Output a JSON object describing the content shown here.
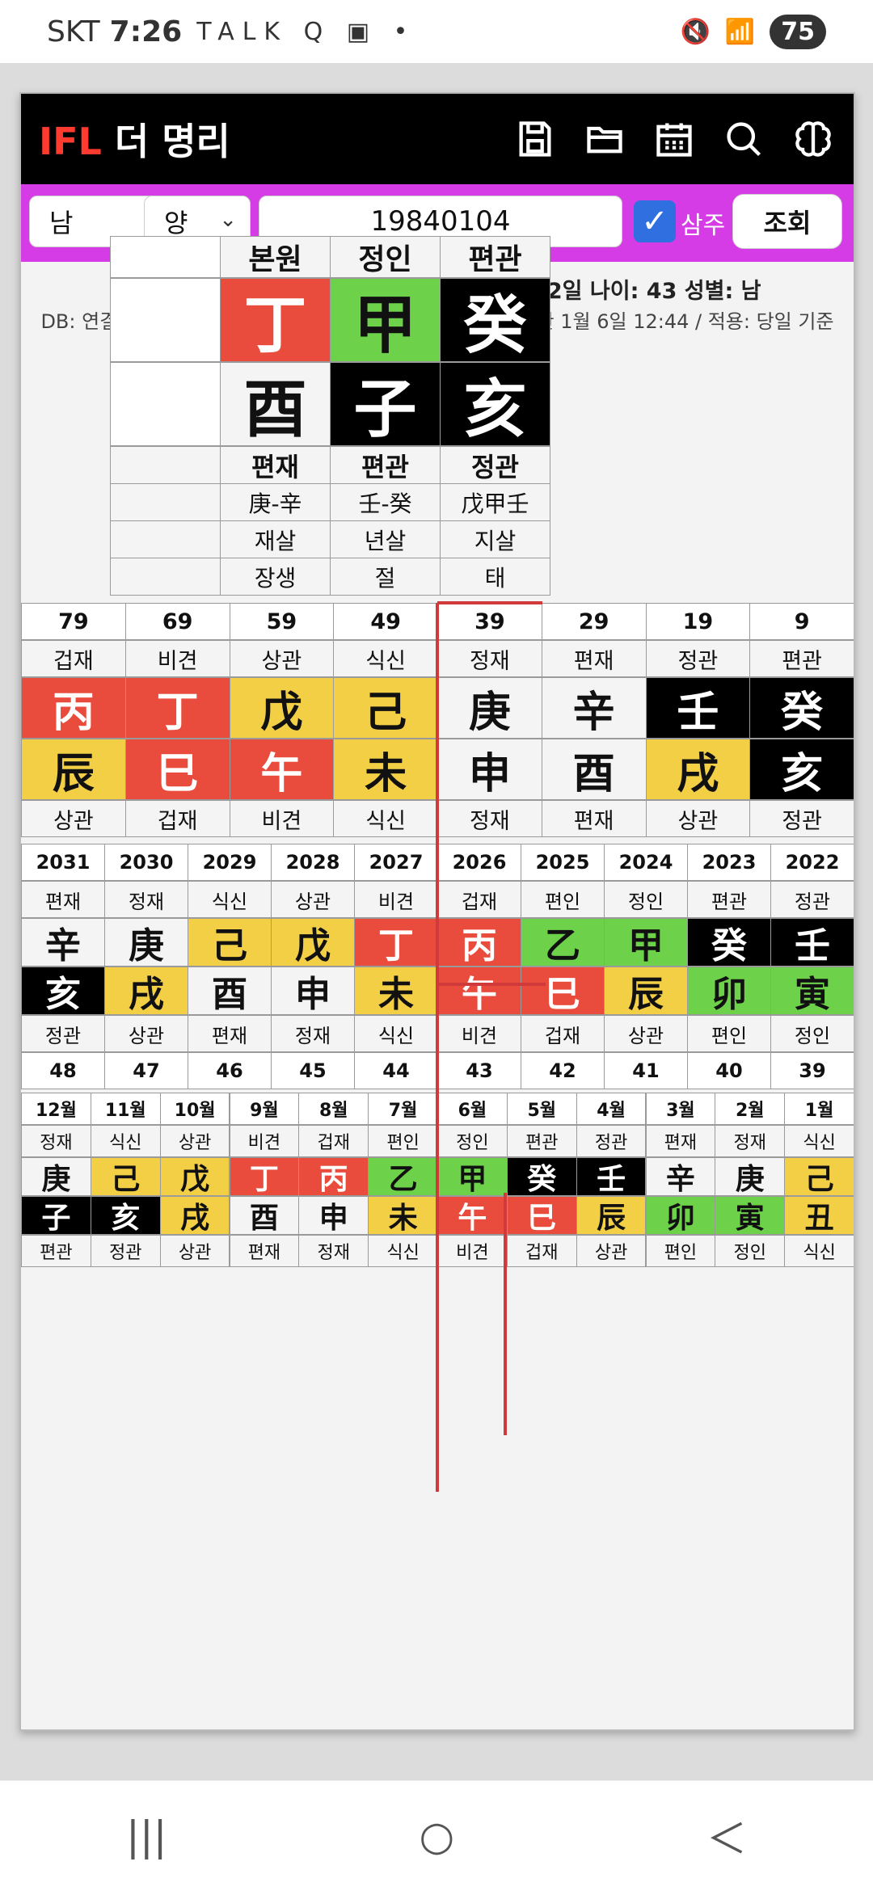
{
  "status": {
    "carrier": "SKT",
    "time": "7:26",
    "left_icons": "TALK Q ▣ •",
    "battery": "75"
  },
  "app": {
    "logo_red": "IFL",
    "logo_white": " 더 명리",
    "tools": [
      "save-icon",
      "folder-icon",
      "calendar-icon",
      "search-icon",
      "brain-icon"
    ]
  },
  "form": {
    "gender": "남",
    "yinyang": "양",
    "date": "19840104",
    "checkbox_label": "삼주",
    "search_label": "조회"
  },
  "info": {
    "line1": "양력: 1984년 1월 4일 음력: 1983년 12월 2일 나이: 43 성별: 남",
    "line2": "DB: 연결 / 현재 절입: 대설 12월 8일 01:31 / 다음 절입: 소한 1월 6일 12:44 / 적용: 당일 기준"
  },
  "pillars": {
    "headers": [
      "본원",
      "정인",
      "편관"
    ],
    "stems": [
      {
        "c": "丁",
        "color": "red"
      },
      {
        "c": "甲",
        "color": "green"
      },
      {
        "c": "癸",
        "color": "black"
      }
    ],
    "branches": [
      {
        "c": "酉",
        "color": "w"
      },
      {
        "c": "子",
        "color": "black"
      },
      {
        "c": "亥",
        "color": "black"
      }
    ],
    "rows": [
      [
        "편재",
        "편관",
        "정관"
      ],
      [
        "庚-辛",
        "壬-癸",
        "戊甲壬"
      ],
      [
        "재살",
        "년살",
        "지살"
      ],
      [
        "장생",
        "절",
        "태"
      ]
    ]
  },
  "daeun": {
    "ages": [
      "79",
      "69",
      "59",
      "49",
      "39",
      "29",
      "19",
      "9"
    ],
    "top_labels": [
      "겁재",
      "비견",
      "상관",
      "식신",
      "정재",
      "편재",
      "정관",
      "편관"
    ],
    "stems": [
      {
        "c": "丙",
        "color": "red"
      },
      {
        "c": "丁",
        "color": "red"
      },
      {
        "c": "戊",
        "color": "yellow"
      },
      {
        "c": "己",
        "color": "yellow"
      },
      {
        "c": "庚",
        "color": "w"
      },
      {
        "c": "辛",
        "color": "w"
      },
      {
        "c": "壬",
        "color": "black"
      },
      {
        "c": "癸",
        "color": "black"
      }
    ],
    "branches": [
      {
        "c": "辰",
        "color": "yellow"
      },
      {
        "c": "巳",
        "color": "red"
      },
      {
        "c": "午",
        "color": "red"
      },
      {
        "c": "未",
        "color": "yellow"
      },
      {
        "c": "申",
        "color": "w"
      },
      {
        "c": "酉",
        "color": "w"
      },
      {
        "c": "戌",
        "color": "yellow"
      },
      {
        "c": "亥",
        "color": "black"
      }
    ],
    "bottom_labels": [
      "상관",
      "겁재",
      "비견",
      "식신",
      "정재",
      "편재",
      "상관",
      "정관"
    ]
  },
  "years": {
    "years": [
      "2031",
      "2030",
      "2029",
      "2028",
      "2027",
      "2026",
      "2025",
      "2024",
      "2023",
      "2022"
    ],
    "top_labels": [
      "편재",
      "정재",
      "식신",
      "상관",
      "비견",
      "겁재",
      "편인",
      "정인",
      "편관",
      "정관"
    ],
    "stems": [
      {
        "c": "辛",
        "color": "w"
      },
      {
        "c": "庚",
        "color": "w"
      },
      {
        "c": "己",
        "color": "yellow"
      },
      {
        "c": "戊",
        "color": "yellow"
      },
      {
        "c": "丁",
        "color": "red"
      },
      {
        "c": "丙",
        "color": "red"
      },
      {
        "c": "乙",
        "color": "green"
      },
      {
        "c": "甲",
        "color": "green"
      },
      {
        "c": "癸",
        "color": "black"
      },
      {
        "c": "壬",
        "color": "black"
      }
    ],
    "branches": [
      {
        "c": "亥",
        "color": "black"
      },
      {
        "c": "戌",
        "color": "yellow"
      },
      {
        "c": "酉",
        "color": "w"
      },
      {
        "c": "申",
        "color": "w"
      },
      {
        "c": "未",
        "color": "yellow"
      },
      {
        "c": "午",
        "color": "red"
      },
      {
        "c": "巳",
        "color": "red"
      },
      {
        "c": "辰",
        "color": "yellow"
      },
      {
        "c": "卯",
        "color": "green"
      },
      {
        "c": "寅",
        "color": "green"
      }
    ],
    "bottom_labels": [
      "정관",
      "상관",
      "편재",
      "정재",
      "식신",
      "비견",
      "겁재",
      "상관",
      "편인",
      "정인"
    ],
    "ages": [
      "48",
      "47",
      "46",
      "45",
      "44",
      "43",
      "42",
      "41",
      "40",
      "39"
    ]
  },
  "months": {
    "months": [
      "12월",
      "11월",
      "10월",
      "9월",
      "8월",
      "7월",
      "6월",
      "5월",
      "4월",
      "3월",
      "2월",
      "1월"
    ],
    "top_labels": [
      "정재",
      "식신",
      "상관",
      "비견",
      "겁재",
      "편인",
      "정인",
      "편관",
      "정관",
      "편재",
      "정재",
      "식신"
    ],
    "stems": [
      {
        "c": "庚",
        "color": "w"
      },
      {
        "c": "己",
        "color": "yellow"
      },
      {
        "c": "戊",
        "color": "yellow"
      },
      {
        "c": "丁",
        "color": "red"
      },
      {
        "c": "丙",
        "color": "red"
      },
      {
        "c": "乙",
        "color": "green"
      },
      {
        "c": "甲",
        "color": "green"
      },
      {
        "c": "癸",
        "color": "black"
      },
      {
        "c": "壬",
        "color": "black"
      },
      {
        "c": "辛",
        "color": "w"
      },
      {
        "c": "庚",
        "color": "w"
      },
      {
        "c": "己",
        "color": "yellow"
      }
    ],
    "branches": [
      {
        "c": "子",
        "color": "black"
      },
      {
        "c": "亥",
        "color": "black"
      },
      {
        "c": "戌",
        "color": "yellow"
      },
      {
        "c": "酉",
        "color": "w"
      },
      {
        "c": "申",
        "color": "w"
      },
      {
        "c": "未",
        "color": "yellow"
      },
      {
        "c": "午",
        "color": "red"
      },
      {
        "c": "巳",
        "color": "red"
      },
      {
        "c": "辰",
        "color": "yellow"
      },
      {
        "c": "卯",
        "color": "green"
      },
      {
        "c": "寅",
        "color": "green"
      },
      {
        "c": "丑",
        "color": "yellow"
      }
    ],
    "bottom_labels": [
      "편관",
      "정관",
      "상관",
      "편재",
      "정재",
      "식신",
      "비견",
      "겁재",
      "상관",
      "편인",
      "정인",
      "식신"
    ]
  },
  "nav": {
    "recent": "|||",
    "home": "○",
    "back": "＜"
  }
}
